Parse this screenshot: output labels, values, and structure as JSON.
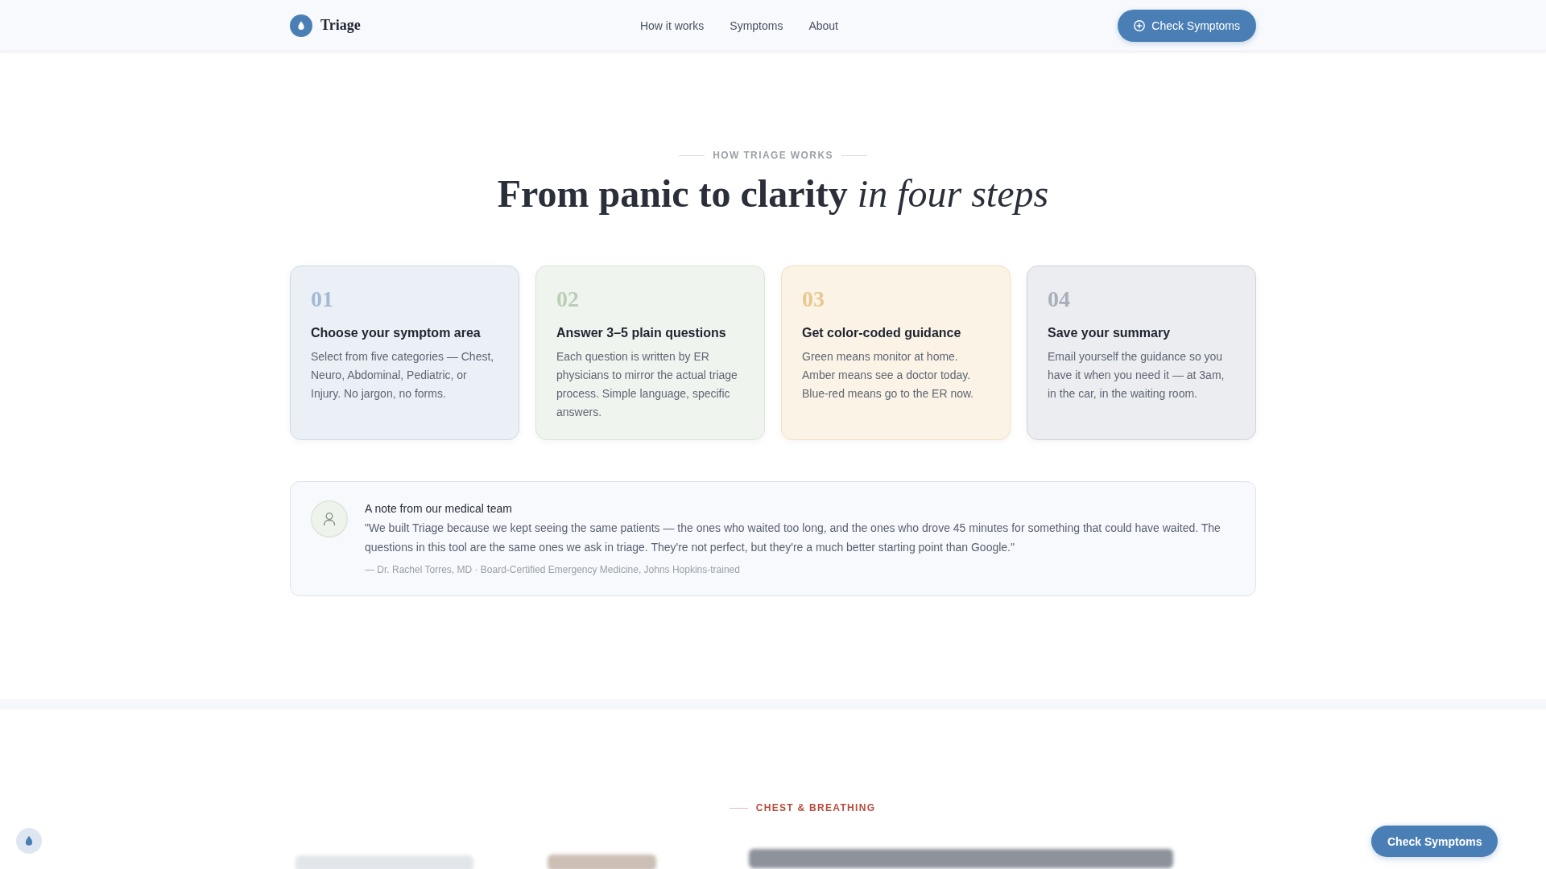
{
  "header": {
    "brand": "Triage",
    "nav": [
      {
        "label": "How it works"
      },
      {
        "label": "Symptoms"
      },
      {
        "label": "About"
      }
    ],
    "cta_button": "Check Symptoms"
  },
  "how_it_works": {
    "eyebrow": "HOW TRIAGE WORKS",
    "title": "**From panic to clarity** *in four steps*",
    "steps": [
      {
        "number": "01",
        "title": "Choose your symptom area",
        "text": "Select from five categories — Chest, Neuro, Abdominal, Pediatric, or Injury. No jargon, no forms.",
        "color": "#a3b9d4"
      },
      {
        "number": "02",
        "title": "Answer 3–5 plain questions",
        "text": "Each question is written by ER physicians to mirror the actual triage process. Simple language, specific answers.",
        "color": "#b9cfb6"
      },
      {
        "number": "03",
        "title": "Get color-coded guidance",
        "text": "Green means monitor at home. Amber means see a doctor today. Blue-red means go to the ER now.",
        "color": "#e8c88f"
      },
      {
        "number": "04",
        "title": "Save your summary",
        "text": "Email yourself the guidance so you have it when you need it — at 3am, in the car, in the waiting room.",
        "color": "#a8aebb"
      }
    ]
  },
  "note": {
    "title": "A note from our medical team",
    "quote": "\"We built Triage because we kept seeing the same patients — the ones who waited too long, and the ones who drove 45 minutes for something that could have waited. The questions in this tool are the same ones we ask in triage. They're not perfect, but they're a much better starting point than Google.\"",
    "attribution": "— Dr. Rachel Torres, MD · Board-Certified Emergency Medicine, Johns Hopkins-trained"
  },
  "next_section": {
    "eyebrow": "CHEST & BREATHING"
  },
  "floating_button": "Check Symptoms"
}
